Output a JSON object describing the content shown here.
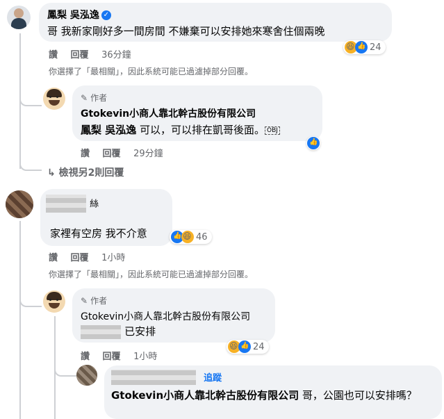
{
  "comment1": {
    "author": "鳳梨 吳泓逸",
    "text": "哥 我新家剛好多一間房間 不嫌棄可以安排她來寒舍住個兩晚",
    "actions": {
      "like": "讚",
      "reply": "回覆",
      "time": "36分鐘"
    },
    "reaction_count": "24",
    "filter_note": "你選擇了「最相關」，因此系統可能已過濾掉部分回覆。"
  },
  "reply1": {
    "badge": "作者",
    "author": "Gtokevin小商人靠北幹古股份有限公司",
    "mention": "鳳梨 吳泓逸",
    "text": " 可以，可以排在凱哥後面。",
    "emoji_box": "OBJ",
    "actions": {
      "like": "讚",
      "reply": "回覆",
      "time": "29分鐘"
    }
  },
  "view_more": "檢視另2則回覆",
  "comment2": {
    "author_suffix": "絲",
    "text": "家裡有空房 我不介意",
    "actions": {
      "like": "讚",
      "reply": "回覆",
      "time": "1小時"
    },
    "reaction_count": "46",
    "filter_note": "你選擇了「最相關」，因此系統可能已過濾掉部分回覆。"
  },
  "reply2": {
    "badge": "作者",
    "author": "Gtokevin小商人靠北幹古股份有限公司",
    "text": "已安排",
    "actions": {
      "like": "讚",
      "reply": "回覆",
      "time": "1小時"
    },
    "reaction_count": "24"
  },
  "reply3": {
    "follow": "追蹤",
    "mention": "Gtokevin小商人靠北幹古股份有限公司",
    "text": " 哥，公園也可以安排嗎？"
  }
}
